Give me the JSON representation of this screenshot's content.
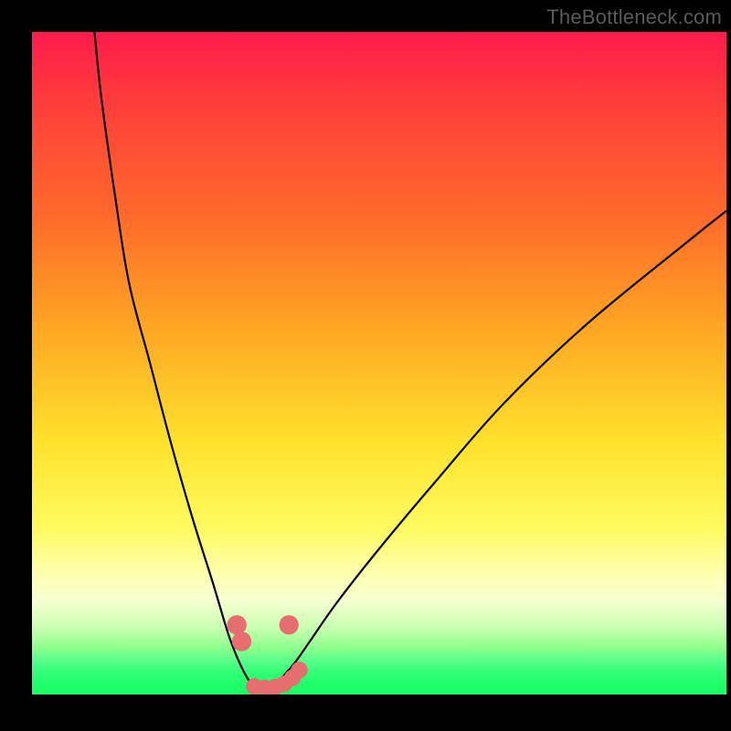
{
  "watermark": "TheBottleneck.com",
  "colors": {
    "background": "#000000",
    "gradient_top": "#ff1b4b",
    "gradient_mid": "#ffe22c",
    "gradient_bottom": "#15ff62",
    "curve": "#000000",
    "markers": "#e76e6e"
  },
  "chart_data": {
    "type": "line",
    "title": "",
    "xlabel": "",
    "ylabel": "",
    "xlim": [
      0,
      100
    ],
    "ylim": [
      0,
      100
    ],
    "grid": false,
    "legend": null,
    "series": [
      {
        "name": "left-branch",
        "x": [
          9,
          10,
          12,
          14,
          17,
          20,
          23,
          26,
          28,
          29,
          30,
          31,
          32
        ],
        "y": [
          100,
          90,
          75,
          62,
          50,
          38,
          27,
          17,
          10,
          7,
          4.5,
          2.5,
          1
        ]
      },
      {
        "name": "right-branch",
        "x": [
          35,
          36,
          38,
          40,
          44,
          50,
          58,
          68,
          80,
          94,
          100
        ],
        "y": [
          1,
          2.5,
          5,
          8,
          14,
          22,
          32,
          44,
          56,
          68,
          73
        ]
      },
      {
        "name": "bottom-connector",
        "x": [
          32,
          33,
          34,
          35
        ],
        "y": [
          1,
          0.7,
          0.7,
          1
        ]
      }
    ],
    "markers": [
      {
        "name": "left-pair-top",
        "x": 29.5,
        "y": 10.5,
        "r": 1.4
      },
      {
        "name": "left-pair-bottom",
        "x": 30.2,
        "y": 8.0,
        "r": 1.4
      },
      {
        "name": "right-single",
        "x": 37.0,
        "y": 10.5,
        "r": 1.4
      },
      {
        "name": "bottom-run-1",
        "x": 32.0,
        "y": 1.2,
        "r": 1.2
      },
      {
        "name": "bottom-run-2",
        "x": 33.5,
        "y": 1.0,
        "r": 1.2
      },
      {
        "name": "bottom-run-3",
        "x": 35.0,
        "y": 1.1,
        "r": 1.2
      },
      {
        "name": "bottom-run-4",
        "x": 36.3,
        "y": 1.6,
        "r": 1.2
      },
      {
        "name": "bottom-tail-5",
        "x": 37.5,
        "y": 2.5,
        "r": 1.2
      },
      {
        "name": "bottom-tail-6",
        "x": 38.5,
        "y": 3.7,
        "r": 1.2
      }
    ]
  }
}
